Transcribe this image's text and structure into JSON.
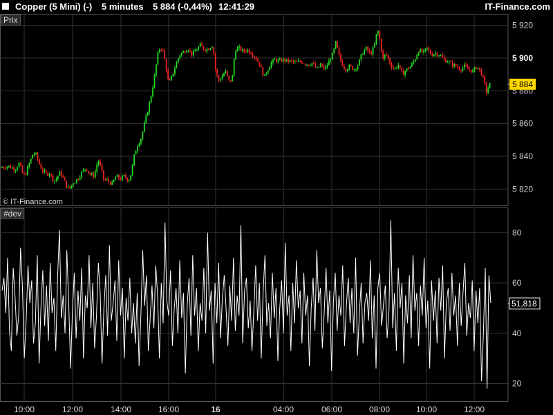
{
  "header": {
    "instrument": "Copper (5 Mini) (-)",
    "timeframe": "5 minutes",
    "quote": "5 884 (-0,44%)",
    "time": "12:41:29",
    "brand": "IT-Finance.com"
  },
  "price_panel": {
    "label": "Prix",
    "watermark": "© IT-Finance.com"
  },
  "dev_panel": {
    "label": "#dev"
  },
  "colors": {
    "up": "#22dd22",
    "down": "#ee2222",
    "grid": "#333333",
    "axis_text": "#cccccc",
    "price_tag": "#ffd700",
    "dev_line": "#ffffff"
  },
  "chart_data": [
    {
      "type": "candlestick",
      "title": "Prix",
      "ylim": [
        5810,
        5927
      ],
      "yticks": [
        5820,
        5840,
        5860,
        5880,
        5900,
        5920
      ],
      "ytick_labels": [
        "5 820",
        "5 840",
        "5 860",
        "5 880",
        "5 900",
        "5 920"
      ],
      "bold_ticks": [
        5900
      ],
      "last_value": 5884,
      "last_label": "5 884",
      "grid": true,
      "close_path": [
        [
          0,
          5833
        ],
        [
          12,
          5834
        ],
        [
          22,
          5832
        ],
        [
          28,
          5836
        ],
        [
          32,
          5830
        ],
        [
          36,
          5828
        ],
        [
          40,
          5833
        ],
        [
          48,
          5842
        ],
        [
          52,
          5841
        ],
        [
          58,
          5834
        ],
        [
          62,
          5831
        ],
        [
          68,
          5829
        ],
        [
          72,
          5830
        ],
        [
          76,
          5826
        ],
        [
          80,
          5825
        ],
        [
          86,
          5830
        ],
        [
          90,
          5828
        ],
        [
          96,
          5822
        ],
        [
          100,
          5820
        ],
        [
          106,
          5824
        ],
        [
          112,
          5826
        ],
        [
          118,
          5830
        ],
        [
          124,
          5833
        ],
        [
          130,
          5829
        ],
        [
          136,
          5828
        ],
        [
          142,
          5838
        ],
        [
          146,
          5833
        ],
        [
          150,
          5826
        ],
        [
          156,
          5825
        ],
        [
          162,
          5823
        ],
        [
          168,
          5828
        ],
        [
          174,
          5826
        ],
        [
          180,
          5828
        ],
        [
          186,
          5825
        ],
        [
          190,
          5830
        ],
        [
          194,
          5840
        ],
        [
          198,
          5846
        ],
        [
          204,
          5851
        ],
        [
          208,
          5858
        ],
        [
          212,
          5865
        ],
        [
          216,
          5872
        ],
        [
          220,
          5880
        ],
        [
          224,
          5890
        ],
        [
          228,
          5902
        ],
        [
          232,
          5907
        ],
        [
          236,
          5904
        ],
        [
          240,
          5895
        ],
        [
          244,
          5884
        ],
        [
          248,
          5888
        ],
        [
          252,
          5893
        ],
        [
          256,
          5898
        ],
        [
          260,
          5902
        ],
        [
          266,
          5904
        ],
        [
          272,
          5906
        ],
        [
          278,
          5902
        ],
        [
          284,
          5905
        ],
        [
          290,
          5908
        ],
        [
          296,
          5905
        ],
        [
          302,
          5906
        ],
        [
          308,
          5908
        ],
        [
          312,
          5892
        ],
        [
          316,
          5886
        ],
        [
          320,
          5888
        ],
        [
          326,
          5892
        ],
        [
          332,
          5885
        ],
        [
          336,
          5888
        ],
        [
          340,
          5905
        ],
        [
          346,
          5906
        ],
        [
          352,
          5904
        ],
        [
          358,
          5905
        ],
        [
          364,
          5903
        ],
        [
          370,
          5900
        ],
        [
          376,
          5896
        ],
        [
          382,
          5888
        ],
        [
          386,
          5892
        ],
        [
          392,
          5897
        ],
        [
          398,
          5899
        ],
        [
          404,
          5898
        ],
        [
          410,
          5899
        ],
        [
          416,
          5898
        ],
        [
          422,
          5898
        ],
        [
          428,
          5897
        ],
        [
          434,
          5898
        ],
        [
          440,
          5897
        ],
        [
          446,
          5896
        ],
        [
          452,
          5897
        ],
        [
          458,
          5893
        ],
        [
          464,
          5896
        ],
        [
          470,
          5893
        ],
        [
          476,
          5898
        ],
        [
          482,
          5903
        ],
        [
          486,
          5910
        ],
        [
          490,
          5902
        ],
        [
          494,
          5897
        ],
        [
          500,
          5893
        ],
        [
          506,
          5895
        ],
        [
          512,
          5893
        ],
        [
          518,
          5896
        ],
        [
          524,
          5903
        ],
        [
          530,
          5906
        ],
        [
          536,
          5902
        ],
        [
          542,
          5908
        ],
        [
          546,
          5918
        ],
        [
          550,
          5910
        ],
        [
          554,
          5899
        ],
        [
          558,
          5903
        ],
        [
          564,
          5897
        ],
        [
          570,
          5893
        ],
        [
          576,
          5896
        ],
        [
          582,
          5890
        ],
        [
          588,
          5893
        ],
        [
          594,
          5895
        ],
        [
          600,
          5899
        ],
        [
          606,
          5905
        ],
        [
          612,
          5903
        ],
        [
          618,
          5906
        ],
        [
          624,
          5902
        ],
        [
          630,
          5903
        ],
        [
          636,
          5902
        ],
        [
          642,
          5899
        ],
        [
          648,
          5898
        ],
        [
          654,
          5896
        ],
        [
          660,
          5895
        ],
        [
          666,
          5893
        ],
        [
          672,
          5895
        ],
        [
          678,
          5893
        ],
        [
          684,
          5892
        ],
        [
          690,
          5895
        ],
        [
          696,
          5891
        ],
        [
          700,
          5886
        ],
        [
          704,
          5879
        ],
        [
          708,
          5884
        ],
        [
          710,
          5884
        ]
      ]
    },
    {
      "type": "line",
      "title": "#dev",
      "ylim": [
        13,
        90
      ],
      "yticks": [
        20,
        40,
        60,
        80
      ],
      "ytick_labels": [
        "20",
        "40",
        "60",
        "80"
      ],
      "last_value": 51.818,
      "last_label": "51,818",
      "grid": true,
      "values": [
        57,
        62,
        48,
        70,
        41,
        33,
        66,
        55,
        39,
        47,
        74,
        58,
        30,
        45,
        67,
        52,
        61,
        36,
        44,
        71,
        28,
        50,
        65,
        43,
        59,
        37,
        68,
        48,
        54,
        33,
        62,
        81,
        46,
        55,
        40,
        73,
        52,
        26,
        49,
        64,
        38,
        57,
        45,
        66,
        30,
        55,
        50,
        71,
        42,
        60,
        34,
        47,
        68,
        56,
        28,
        50,
        63,
        39,
        75,
        45,
        52,
        61,
        37,
        69,
        47,
        58,
        30,
        54,
        45,
        62,
        40,
        52,
        36,
        56,
        27,
        48,
        73,
        51,
        63,
        33,
        46,
        59,
        42,
        67,
        55,
        30,
        60,
        44,
        84,
        53,
        47,
        65,
        35,
        50,
        58,
        40,
        69,
        46,
        56,
        24,
        51,
        62,
        39,
        71,
        47,
        58,
        33,
        52,
        45,
        66,
        40,
        80,
        49,
        57,
        28,
        60,
        44,
        68,
        38,
        54,
        63,
        50,
        35,
        59,
        45,
        70,
        41,
        55,
        47,
        83,
        36,
        57,
        62,
        42,
        53,
        33,
        49,
        67,
        45,
        60,
        30,
        56,
        71,
        43,
        52,
        38,
        64,
        46,
        58,
        29,
        50,
        61,
        40,
        76,
        47,
        55,
        33,
        60,
        44,
        69,
        50,
        57,
        36,
        64,
        47,
        55,
        27,
        50,
        62,
        41,
        73,
        52,
        58,
        34,
        48,
        66,
        44,
        57,
        25,
        53,
        64,
        41,
        55,
        47,
        67,
        35,
        51,
        62,
        44,
        58,
        40,
        70,
        31,
        48,
        60,
        36,
        52,
        56,
        45,
        69,
        38,
        55,
        26,
        58,
        64,
        43,
        51,
        59,
        38,
        49,
        85,
        42,
        56,
        33,
        66,
        50,
        60,
        28,
        55,
        44,
        63,
        38,
        71,
        49,
        56,
        35,
        59,
        47,
        70,
        42,
        53,
        26,
        61,
        45,
        57,
        36,
        62,
        49,
        67,
        30,
        52,
        58,
        41,
        64,
        47,
        55,
        35,
        60,
        43,
        56,
        68,
        39,
        52,
        46,
        61,
        33,
        57,
        44,
        58,
        21,
        40,
        66,
        18,
        63,
        52
      ]
    }
  ],
  "x_axis": {
    "labels": [
      "10:00",
      "12:00",
      "14:00",
      "16:00",
      "16",
      "04:00",
      "06:00",
      "08:00",
      "10:00",
      "12:00"
    ],
    "bold_index": 4
  }
}
